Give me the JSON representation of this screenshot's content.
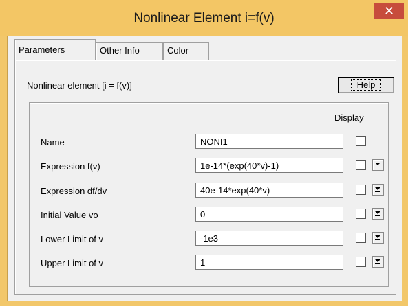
{
  "window": {
    "title": "Nonlinear Element i=f(v)",
    "close_glyph": "✕"
  },
  "tabs": [
    {
      "label": "Parameters",
      "active": true
    },
    {
      "label": "Other Info",
      "active": false
    },
    {
      "label": "Color",
      "active": false
    }
  ],
  "panel": {
    "header": "Nonlinear element [i = f(v)]",
    "help_label": "Help",
    "display_label": "Display"
  },
  "rows": [
    {
      "label": "Name",
      "value": "NONI1",
      "display_checked": false,
      "has_dropdown": false
    },
    {
      "label": "Expression f(v)",
      "value": "1e-14*(exp(40*v)-1)",
      "display_checked": false,
      "has_dropdown": true
    },
    {
      "label": "Expression df/dv",
      "value": "40e-14*exp(40*v)",
      "display_checked": false,
      "has_dropdown": true
    },
    {
      "label": "Initial Value vo",
      "value": "0",
      "display_checked": false,
      "has_dropdown": true
    },
    {
      "label": "Lower Limit of v",
      "value": "-1e3",
      "display_checked": false,
      "has_dropdown": true
    },
    {
      "label": "Upper Limit of v",
      "value": "1",
      "display_checked": false,
      "has_dropdown": true
    }
  ],
  "colors": {
    "title_bar": "#f3c665",
    "close_button": "#c74c3c",
    "dialog_bg": "#f0f0f0"
  }
}
